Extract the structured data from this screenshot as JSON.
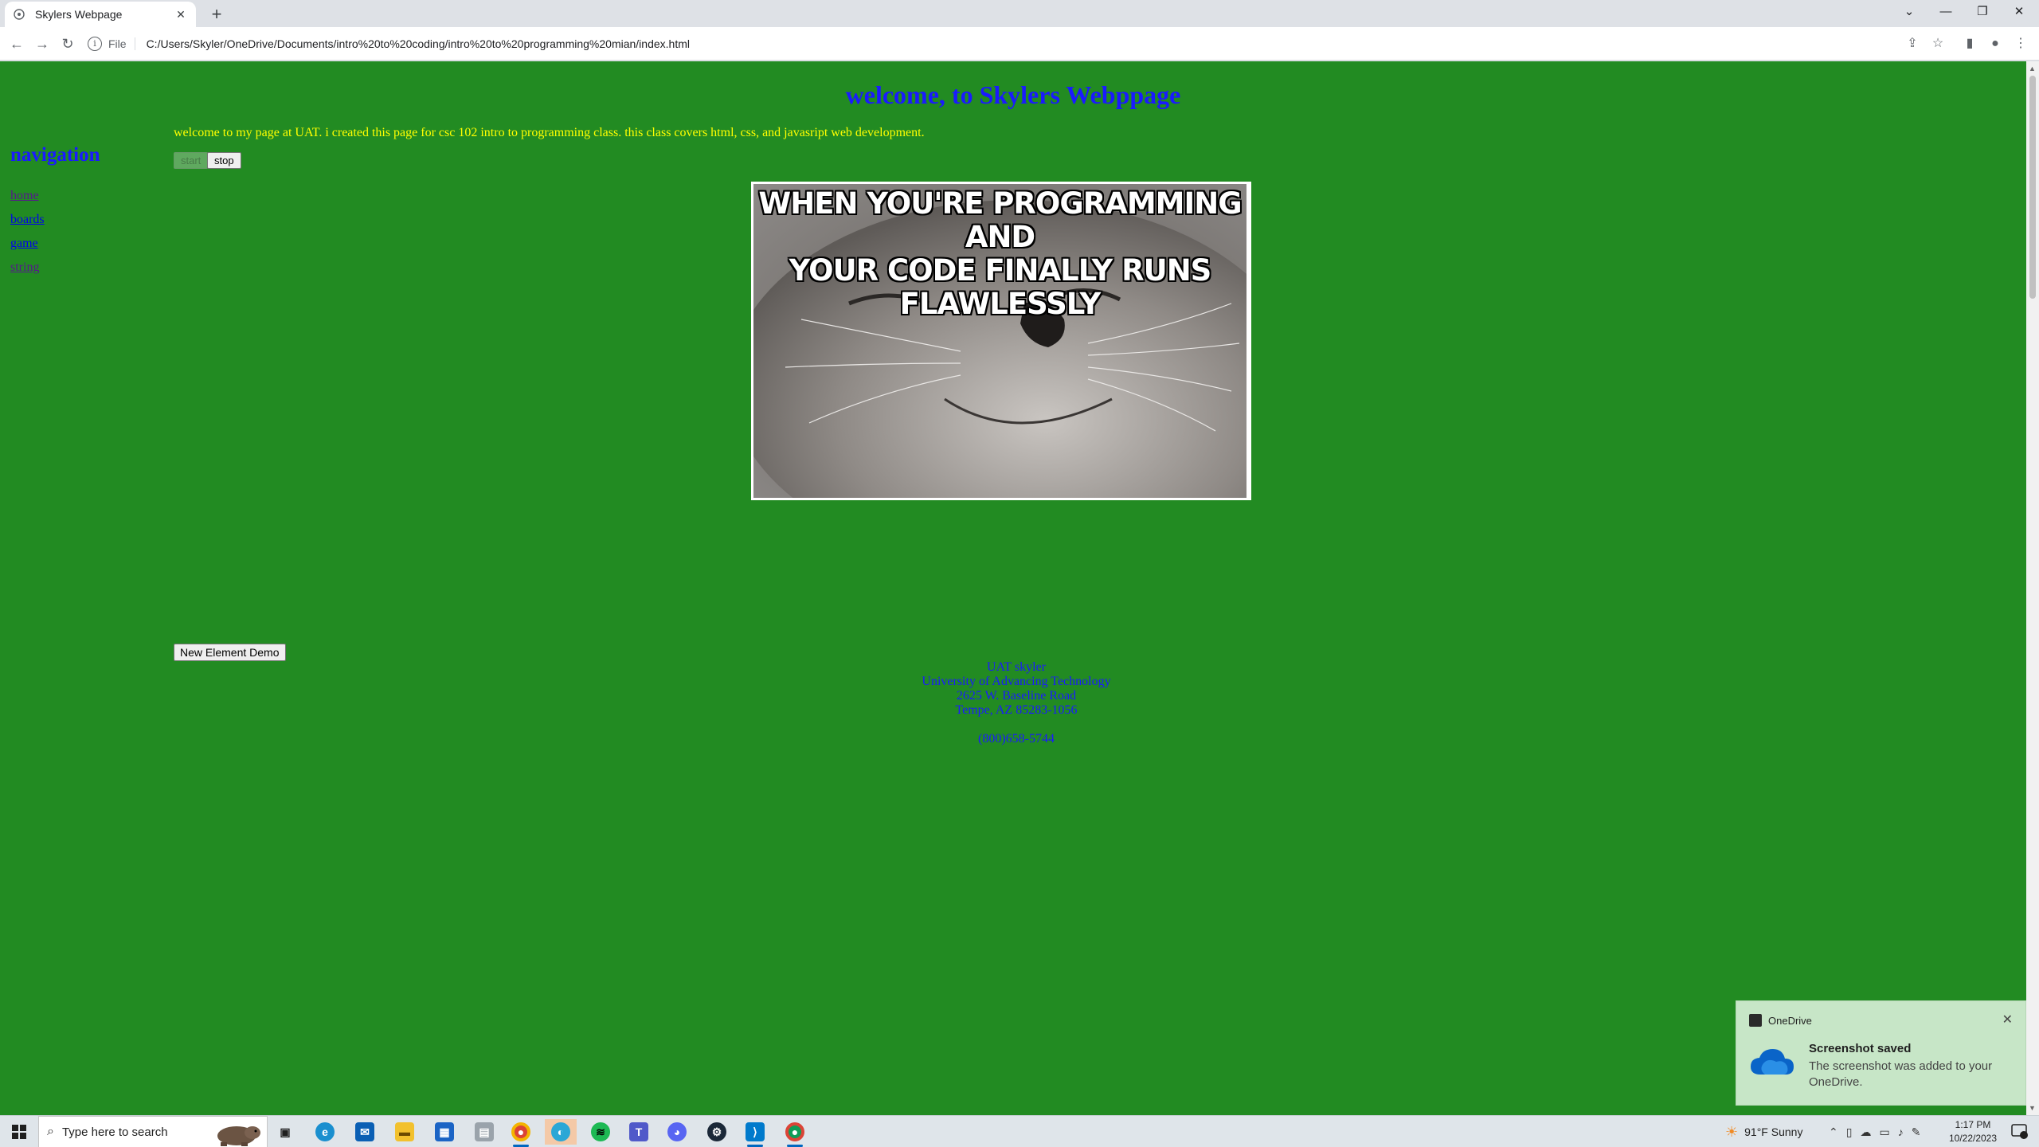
{
  "browser": {
    "tab_title": "Skylers Webpage",
    "tab_close": "✕",
    "new_tab": "+",
    "scheme_label": "File",
    "url": "C:/Users/Skyler/OneDrive/Documents/intro%20to%20coding/intro%20to%20programming%20mian/index.html"
  },
  "page": {
    "heading": "welcome, to Skylers Webppage",
    "intro": "welcome to my page at UAT. i created this page for csc 102 intro to programming class. this class covers html, css, and javasript web development.",
    "nav_title": "navigation",
    "nav_links": [
      {
        "label": "home",
        "state": "visited"
      },
      {
        "label": "boards",
        "state": "link"
      },
      {
        "label": "game",
        "state": "link"
      },
      {
        "label": "string",
        "state": "visited"
      }
    ],
    "start_label": "start",
    "stop_label": "stop",
    "meme_caption_line1": "WHEN YOU'RE PROGRAMMING AND",
    "meme_caption_line2": "YOUR CODE FINALLY RUNS FLAWLESSLY",
    "new_element_label": "New Element Demo",
    "footer": {
      "name": "UAT skyler",
      "school": "University of Advancing Technology",
      "street": "2625 W. Baseline Road",
      "city": "Tempe, AZ 85283-1056",
      "phone": "(800)658-5744"
    }
  },
  "toast": {
    "app": "OneDrive",
    "headline": "Screenshot saved",
    "body": "The screenshot was added to your OneDrive."
  },
  "taskbar": {
    "search_placeholder": "Type here to search",
    "weather": "91°F  Sunny",
    "time": "1:17 PM",
    "date": "10/22/2023"
  },
  "colors": {
    "page_background": "#228b22",
    "heading": "#1a1aff",
    "intro_text": "#ffff00",
    "toast_background": "#c7e6c7"
  }
}
